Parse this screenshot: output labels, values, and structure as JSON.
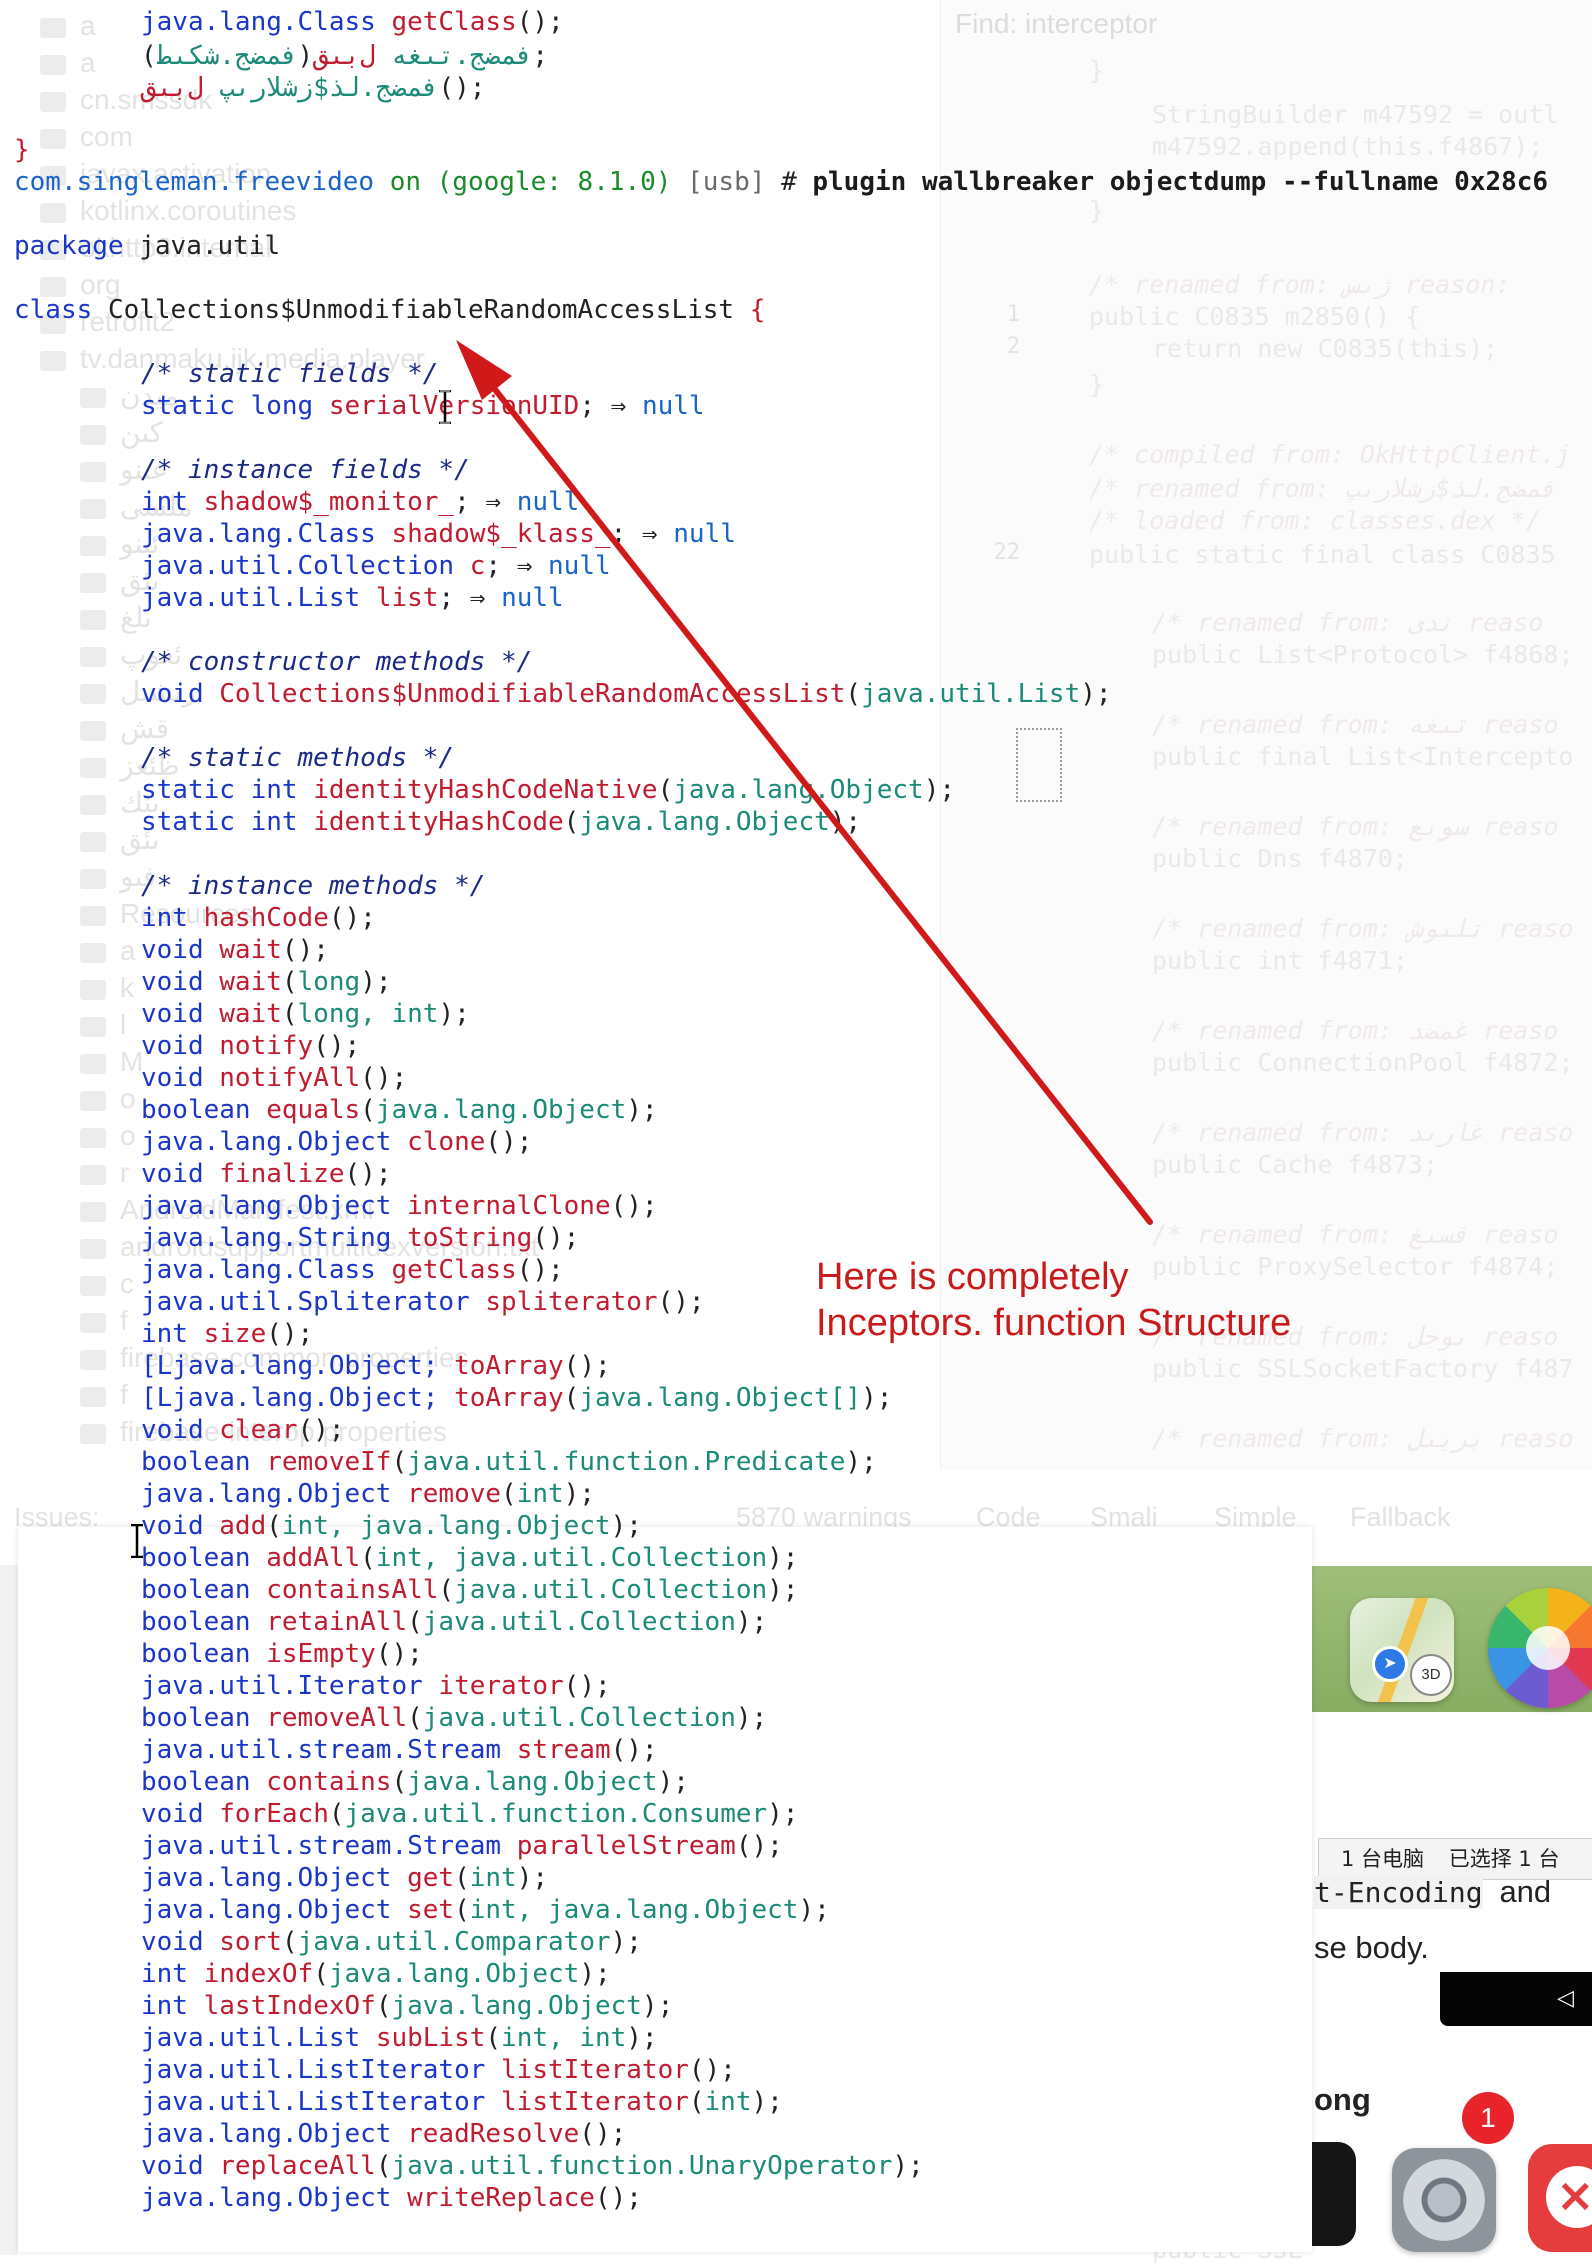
{
  "background_ide": {
    "find_placeholder": "Find: interceptor",
    "tree_items": [
      "a",
      "a",
      "cn.smssdk",
      "com",
      "javax.activation",
      "kotlinx.coroutines",
      "okhttp3.internal",
      "org",
      "retrofit2",
      "tv.danmaku.ijk.media.player",
      "ميدن",
      "كىن",
      "عىنو",
      "ملسى",
      "ئىنو",
      "ىئق",
      "ىلغ",
      "ئغوپ",
      "رىشىل",
      "قش",
      "ظئعز",
      "ىئك",
      "ىئق",
      "فىو",
      "Resources",
      "a",
      "k",
      "l",
      "M",
      "o",
      "o",
      "r",
      "AndroidManifest.xml",
      "androidsupportmultidexversion.txt",
      "c",
      "f",
      "firebase-common.properties",
      "f",
      "firebase-interop.properties"
    ],
    "tree_items_lower": [
      "a",
      "a",
      "ىق",
      "Resources",
      "a",
      "k",
      "l",
      "M",
      "o",
      "o",
      "r",
      "AndroidManifest.xml",
      "a",
      "c",
      "f",
      "f",
      "firebase-common.properties"
    ],
    "editor_lines": [
      {
        "n": "",
        "t": "}"
      },
      {
        "n": "",
        "t": "StringBuilder m47592 = outl"
      },
      {
        "n": "",
        "t": "m47592.append(this.f4867);"
      },
      {
        "n": "",
        "t": "}"
      },
      {
        "n": "",
        "t": "/* renamed from: ژىس reason:"
      },
      {
        "n": "1",
        "t": "public C0835 m2850() {"
      },
      {
        "n": "2",
        "t": "return new C0835(this);"
      },
      {
        "n": "",
        "t": "}"
      },
      {
        "n": "",
        "t": "/* compiled from: OkHttpClient.j"
      },
      {
        "n": "",
        "t": "/* renamed from: فمضج.لذ$زشلارىپ"
      },
      {
        "n": "",
        "t": "/* loaded from: classes.dex */"
      },
      {
        "n": "22",
        "t": "public static final class C0835"
      },
      {
        "n": "",
        "t": "/* renamed from: ندى  reaso"
      },
      {
        "n": "",
        "t": "public List<Protocol> f4868;"
      },
      {
        "n": "",
        "t": "/* renamed from: تىغه  reaso"
      },
      {
        "n": "",
        "t": "public final List<Intercepto"
      },
      {
        "n": "",
        "t": "/* renamed from: سوىع  reaso"
      },
      {
        "n": "",
        "t": "public Dns f4870;"
      },
      {
        "n": "",
        "t": "/* renamed from: تلىوش  reaso"
      },
      {
        "n": "",
        "t": "public int f4871;"
      },
      {
        "n": "",
        "t": "/* renamed from: غمضد  reaso"
      },
      {
        "n": "",
        "t": "public ConnectionPool f4872;"
      },
      {
        "n": "",
        "t": "/* renamed from: غارىد  reaso"
      },
      {
        "n": "",
        "t": "public Cache f4873;"
      },
      {
        "n": "",
        "t": "/* renamed from: قسىغ  reaso"
      },
      {
        "n": "",
        "t": "public ProxySelector f4874;"
      },
      {
        "n": "",
        "t": "/* renamed from: ىوجل  reaso"
      },
      {
        "n": "",
        "t": "public SSLSocketFactory f487"
      },
      {
        "n": "",
        "t": "/* renamed from: بريىل  reaso"
      }
    ],
    "editor_lines_lower": [
      "/* renamed",
      "public fin",
      "/* renamed",
      "public Dns",
      "/* renamed",
      "public int",
      "/* renamed",
      "public Cor",
      "/* renamed",
      "public Cac",
      "/* renamed",
      "public Pro",
      "/* renamed",
      "public SSL"
    ],
    "bottom_tabs": [
      "Issues:",
      "5870 warnings",
      "Code",
      "Smali",
      "Simple",
      "Fallback"
    ]
  },
  "terminal_top": {
    "line_getclass": {
      "type": "java.lang.Class",
      "name": "getClass",
      "rest": "();"
    },
    "line_rtl1": {
      "type": "فمضج.تىغه",
      "name": "ل‌بىق",
      "args": "فمضج.شكىط",
      "rest": ");"
    },
    "line_rtl2": {
      "type": "فمضج.لذ$زشلارىپ",
      "name": "ل‌بىق",
      "rest": "();"
    },
    "close_brace": "}"
  },
  "prompt": {
    "package": "com.singleman.freevideo",
    "on": "on",
    "device": "(google: 8.1.0)",
    "usb": "[usb]",
    "hash": "#",
    "command": "plugin wallbreaker objectdump --fullname 0x28c6"
  },
  "dump": {
    "package_kw": "package",
    "package_name": "java.util",
    "class_kw": "class",
    "class_name": "Collections$UnmodifiableRandomAccessList",
    "open_brace": "{",
    "static_fields_comment": "/* static fields */",
    "static_fields": [
      {
        "mod": "static",
        "type": "long",
        "name": "serialVersionUID",
        "value": "null"
      }
    ],
    "instance_fields_comment": "/* instance fields */",
    "instance_fields": [
      {
        "type": "int",
        "name": "shadow$_monitor_",
        "value": "null"
      },
      {
        "type": "java.lang.Class",
        "name": "shadow$_klass_",
        "value": "null"
      },
      {
        "type": "java.util.Collection",
        "name": "c",
        "value": "null"
      },
      {
        "type": "java.util.List",
        "name": "list",
        "value": "null"
      }
    ],
    "arrow": "⇒",
    "constructor_comment": "/* constructor methods */",
    "constructor": {
      "type": "void",
      "name": "Collections$UnmodifiableRandomAccessList",
      "args": "java.util.List"
    },
    "static_methods_comment": "/* static methods */",
    "static_methods": [
      {
        "mod": "static",
        "type": "int",
        "name": "identityHashCodeNative",
        "args": "java.lang.Object"
      },
      {
        "mod": "static",
        "type": "int",
        "name": "identityHashCode",
        "args": "java.lang.Object"
      }
    ],
    "instance_methods_comment": "/* instance methods */",
    "instance_methods": [
      {
        "type": "int",
        "name": "hashCode",
        "args": ""
      },
      {
        "type": "void",
        "name": "wait",
        "args": ""
      },
      {
        "type": "void",
        "name": "wait",
        "args": "long"
      },
      {
        "type": "void",
        "name": "wait",
        "args": "long, int"
      },
      {
        "type": "void",
        "name": "notify",
        "args": ""
      },
      {
        "type": "void",
        "name": "notifyAll",
        "args": ""
      },
      {
        "type": "boolean",
        "name": "equals",
        "args": "java.lang.Object"
      },
      {
        "type": "java.lang.Object",
        "name": "clone",
        "args": ""
      },
      {
        "type": "void",
        "name": "finalize",
        "args": ""
      },
      {
        "type": "java.lang.Object",
        "name": "internalClone",
        "args": ""
      },
      {
        "type": "java.lang.String",
        "name": "toString",
        "args": ""
      },
      {
        "type": "java.lang.Class",
        "name": "getClass",
        "args": ""
      },
      {
        "type": "java.util.Spliterator",
        "name": "spliterator",
        "args": ""
      },
      {
        "type": "int",
        "name": "size",
        "args": ""
      },
      {
        "type": "[Ljava.lang.Object;",
        "name": "toArray",
        "args": ""
      },
      {
        "type": "[Ljava.lang.Object;",
        "name": "toArray",
        "args": "java.lang.Object[]"
      },
      {
        "type": "void",
        "name": "clear",
        "args": ""
      },
      {
        "type": "boolean",
        "name": "removeIf",
        "args": "java.util.function.Predicate"
      },
      {
        "type": "java.lang.Object",
        "name": "remove",
        "args": "int"
      },
      {
        "type": "void",
        "name": "add",
        "args": "int, java.lang.Object"
      },
      {
        "type": "boolean",
        "name": "addAll",
        "args": "int, java.util.Collection"
      },
      {
        "type": "boolean",
        "name": "containsAll",
        "args": "java.util.Collection"
      },
      {
        "type": "boolean",
        "name": "retainAll",
        "args": "java.util.Collection"
      },
      {
        "type": "boolean",
        "name": "isEmpty",
        "args": ""
      },
      {
        "type": "java.util.Iterator",
        "name": "iterator",
        "args": ""
      },
      {
        "type": "boolean",
        "name": "removeAll",
        "args": "java.util.Collection"
      },
      {
        "type": "java.util.stream.Stream",
        "name": "stream",
        "args": ""
      },
      {
        "type": "boolean",
        "name": "contains",
        "args": "java.lang.Object"
      },
      {
        "type": "void",
        "name": "forEach",
        "args": "java.util.function.Consumer"
      },
      {
        "type": "java.util.stream.Stream",
        "name": "parallelStream",
        "args": ""
      },
      {
        "type": "java.lang.Object",
        "name": "get",
        "args": "int"
      },
      {
        "type": "java.lang.Object",
        "name": "set",
        "args": "int, java.lang.Object"
      },
      {
        "type": "void",
        "name": "sort",
        "args": "java.util.Comparator"
      },
      {
        "type": "int",
        "name": "indexOf",
        "args": "java.lang.Object"
      },
      {
        "type": "int",
        "name": "lastIndexOf",
        "args": "java.lang.Object"
      },
      {
        "type": "java.util.List",
        "name": "subList",
        "args": "int, int"
      },
      {
        "type": "java.util.ListIterator",
        "name": "listIterator",
        "args": ""
      },
      {
        "type": "java.util.ListIterator",
        "name": "listIterator",
        "args": "int"
      },
      {
        "type": "java.lang.Object",
        "name": "readResolve",
        "args": ""
      },
      {
        "type": "void",
        "name": "replaceAll",
        "args": "java.util.function.UnaryOperator"
      },
      {
        "type": "java.lang.Object",
        "name": "writeReplace",
        "args": ""
      }
    ]
  },
  "annotation": {
    "line1": "Here is completely",
    "line2": "Inceptors. function Structure",
    "color": "#c91b1b"
  },
  "desktop": {
    "maps_3d_label": "3D",
    "device_selector": {
      "count_label": "1 台电脑",
      "selected_label": "已选择 1 台"
    },
    "snippet_1_mono": "t-Encoding",
    "snippet_1_sans": "and",
    "snippet_2": "se body.",
    "snippet_3": "ong",
    "settings_badge": "1"
  }
}
